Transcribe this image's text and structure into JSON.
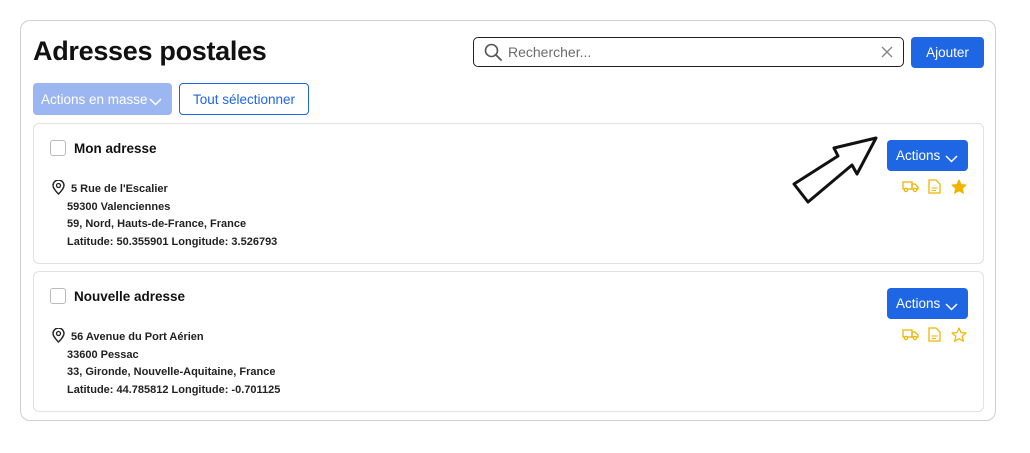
{
  "header": {
    "title": "Adresses postales",
    "search_placeholder": "Rechercher...",
    "search_value": "",
    "add_label": "Ajouter"
  },
  "toolbar": {
    "bulk_actions_label": "Actions en masse",
    "select_all_label": "Tout sélectionner"
  },
  "addresses": [
    {
      "title": "Mon adresse",
      "line1": "5 Rue de l'Escalier",
      "line2": "59300 Valenciennes",
      "line3": "59, Nord, Hauts-de-France,  France",
      "line4": "Latitude: 50.355901 Longitude: 3.526793",
      "actions_label": "Actions",
      "favorite": true
    },
    {
      "title": "Nouvelle adresse",
      "line1": "56 Avenue du Port Aérien",
      "line2": "33600 Pessac",
      "line3": "33, Gironde, Nouvelle-Aquitaine,  France",
      "line4": "Latitude: 44.785812 Longitude: -0.701125",
      "actions_label": "Actions",
      "favorite": false
    }
  ],
  "colors": {
    "primary": "#1f66e5",
    "primary_disabled": "#9bb6f0",
    "icon_accent": "#f0b400",
    "border": "#cfcfd4"
  },
  "icons": [
    "search-icon",
    "close-icon",
    "chevron-down-icon",
    "map-pin-icon",
    "truck-icon",
    "document-icon",
    "star-icon",
    "arrow-annotation"
  ]
}
